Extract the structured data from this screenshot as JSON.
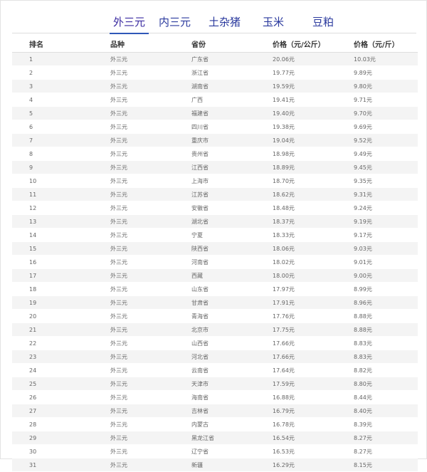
{
  "tabs": [
    {
      "label": "外三元",
      "active": true
    },
    {
      "label": "内三元",
      "active": false
    },
    {
      "label": "土杂猪",
      "active": false
    },
    {
      "label": "玉米",
      "active": false
    },
    {
      "label": "豆粕",
      "active": false
    }
  ],
  "table": {
    "headers": [
      "排名",
      "品种",
      "省份",
      "价格（元/公斤）",
      "价格（元/斤）"
    ],
    "rows": [
      [
        "1",
        "外三元",
        "广东省",
        "20.06元",
        "10.03元"
      ],
      [
        "2",
        "外三元",
        "浙江省",
        "19.77元",
        "9.89元"
      ],
      [
        "3",
        "外三元",
        "湖南省",
        "19.59元",
        "9.80元"
      ],
      [
        "4",
        "外三元",
        "广西",
        "19.41元",
        "9.71元"
      ],
      [
        "5",
        "外三元",
        "福建省",
        "19.40元",
        "9.70元"
      ],
      [
        "6",
        "外三元",
        "四川省",
        "19.38元",
        "9.69元"
      ],
      [
        "7",
        "外三元",
        "重庆市",
        "19.04元",
        "9.52元"
      ],
      [
        "8",
        "外三元",
        "贵州省",
        "18.98元",
        "9.49元"
      ],
      [
        "9",
        "外三元",
        "江西省",
        "18.89元",
        "9.45元"
      ],
      [
        "10",
        "外三元",
        "上海市",
        "18.70元",
        "9.35元"
      ],
      [
        "11",
        "外三元",
        "江苏省",
        "18.62元",
        "9.31元"
      ],
      [
        "12",
        "外三元",
        "安徽省",
        "18.48元",
        "9.24元"
      ],
      [
        "13",
        "外三元",
        "湖北省",
        "18.37元",
        "9.19元"
      ],
      [
        "14",
        "外三元",
        "宁夏",
        "18.33元",
        "9.17元"
      ],
      [
        "15",
        "外三元",
        "陕西省",
        "18.06元",
        "9.03元"
      ],
      [
        "16",
        "外三元",
        "河南省",
        "18.02元",
        "9.01元"
      ],
      [
        "17",
        "外三元",
        "西藏",
        "18.00元",
        "9.00元"
      ],
      [
        "18",
        "外三元",
        "山东省",
        "17.97元",
        "8.99元"
      ],
      [
        "19",
        "外三元",
        "甘肃省",
        "17.91元",
        "8.96元"
      ],
      [
        "20",
        "外三元",
        "青海省",
        "17.76元",
        "8.88元"
      ],
      [
        "21",
        "外三元",
        "北京市",
        "17.75元",
        "8.88元"
      ],
      [
        "22",
        "外三元",
        "山西省",
        "17.66元",
        "8.83元"
      ],
      [
        "23",
        "外三元",
        "河北省",
        "17.66元",
        "8.83元"
      ],
      [
        "24",
        "外三元",
        "云南省",
        "17.64元",
        "8.82元"
      ],
      [
        "25",
        "外三元",
        "天津市",
        "17.59元",
        "8.80元"
      ],
      [
        "26",
        "外三元",
        "海南省",
        "16.88元",
        "8.44元"
      ],
      [
        "27",
        "外三元",
        "吉林省",
        "16.79元",
        "8.40元"
      ],
      [
        "28",
        "外三元",
        "内蒙古",
        "16.78元",
        "8.39元"
      ],
      [
        "29",
        "外三元",
        "黑龙江省",
        "16.54元",
        "8.27元"
      ],
      [
        "30",
        "外三元",
        "辽宁省",
        "16.53元",
        "8.27元"
      ],
      [
        "31",
        "外三元",
        "新疆",
        "16.29元",
        "8.15元"
      ]
    ]
  }
}
